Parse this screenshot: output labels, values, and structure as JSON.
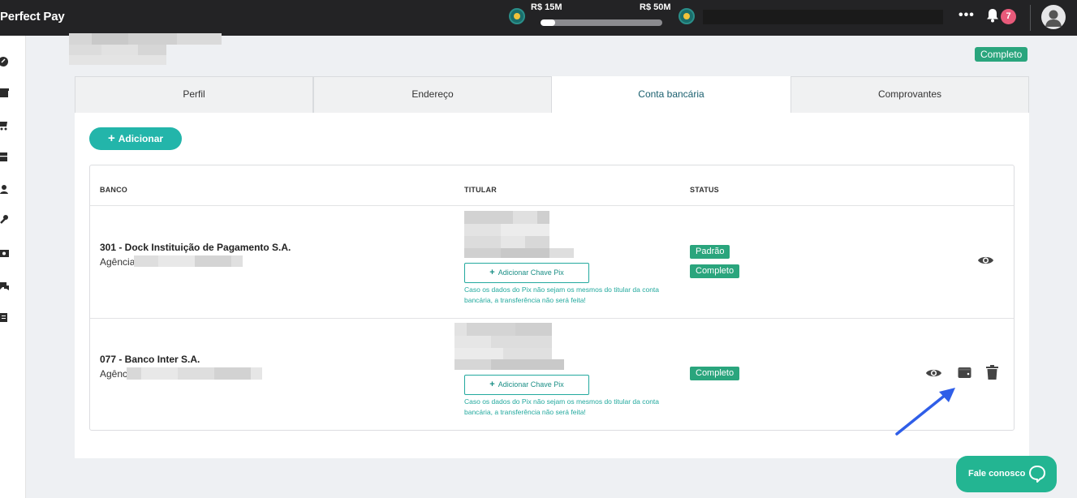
{
  "topbar": {
    "brand": "Perfect Pay",
    "milestone_left": "R$ 15M",
    "milestone_right": "R$ 50M",
    "progress_fraction": 0.12,
    "more_label": "•••",
    "notification_count": "7"
  },
  "account": {
    "status_badge": "Completo"
  },
  "tabs": [
    {
      "label": "Perfil"
    },
    {
      "label": "Endereço"
    },
    {
      "label": "Conta bancária"
    },
    {
      "label": "Comprovantes"
    }
  ],
  "add_button": {
    "label": "Adicionar"
  },
  "table": {
    "headers": {
      "banco": "BANCO",
      "titular": "TITULAR",
      "status": "STATUS"
    },
    "rows": [
      {
        "bank": "301 - Dock Instituição de Pagamento S.A.",
        "agencia_label": "Agência",
        "pix_button": "Adicionar Chave Pix",
        "pix_note": "Caso os dados do Pix não sejam os mesmos do titular da conta bancária, a transferência não será feita!",
        "status": [
          "Padrão",
          "Completo"
        ]
      },
      {
        "bank": "077 - Banco Inter S.A.",
        "agencia_label": "Agênc",
        "pix_button": "Adicionar Chave Pix",
        "pix_note": "Caso os dados do Pix não sejam os mesmos do titular da conta bancária, a transferência não será feita!",
        "status": [
          "Completo"
        ]
      }
    ]
  },
  "chat": {
    "label": "Fale conosco"
  },
  "colors": {
    "topbar": "#232325",
    "accent": "#23b5aa",
    "status_green": "#2aa57d",
    "annotation_arrow": "#2f5ee8"
  }
}
